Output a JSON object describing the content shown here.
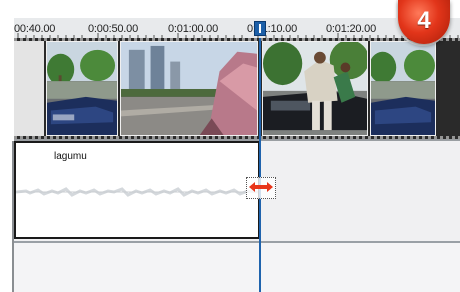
{
  "ruler": {
    "labels": [
      "00:40.00",
      "0:00:50.00",
      "0:01:00.00",
      "0:01:10.00",
      "0:01:20.00"
    ],
    "playhead_time_partial": "0:01:10.00"
  },
  "video_track": {
    "frames": [
      "city-street-car-frame",
      "high-rise-buildings-frame",
      "city-street-car-frame",
      "people-pushing-car-frame",
      "city-street-car-frame"
    ]
  },
  "audio_track": {
    "clip_label": "lagumu"
  },
  "step_badge": {
    "number": "4"
  },
  "colors": {
    "playhead": "#1f63ad",
    "trim_arrow": "#e8361b",
    "badge": "#e2351a"
  },
  "icons": {
    "trim_cursor": "resize-horizontal-icon"
  }
}
